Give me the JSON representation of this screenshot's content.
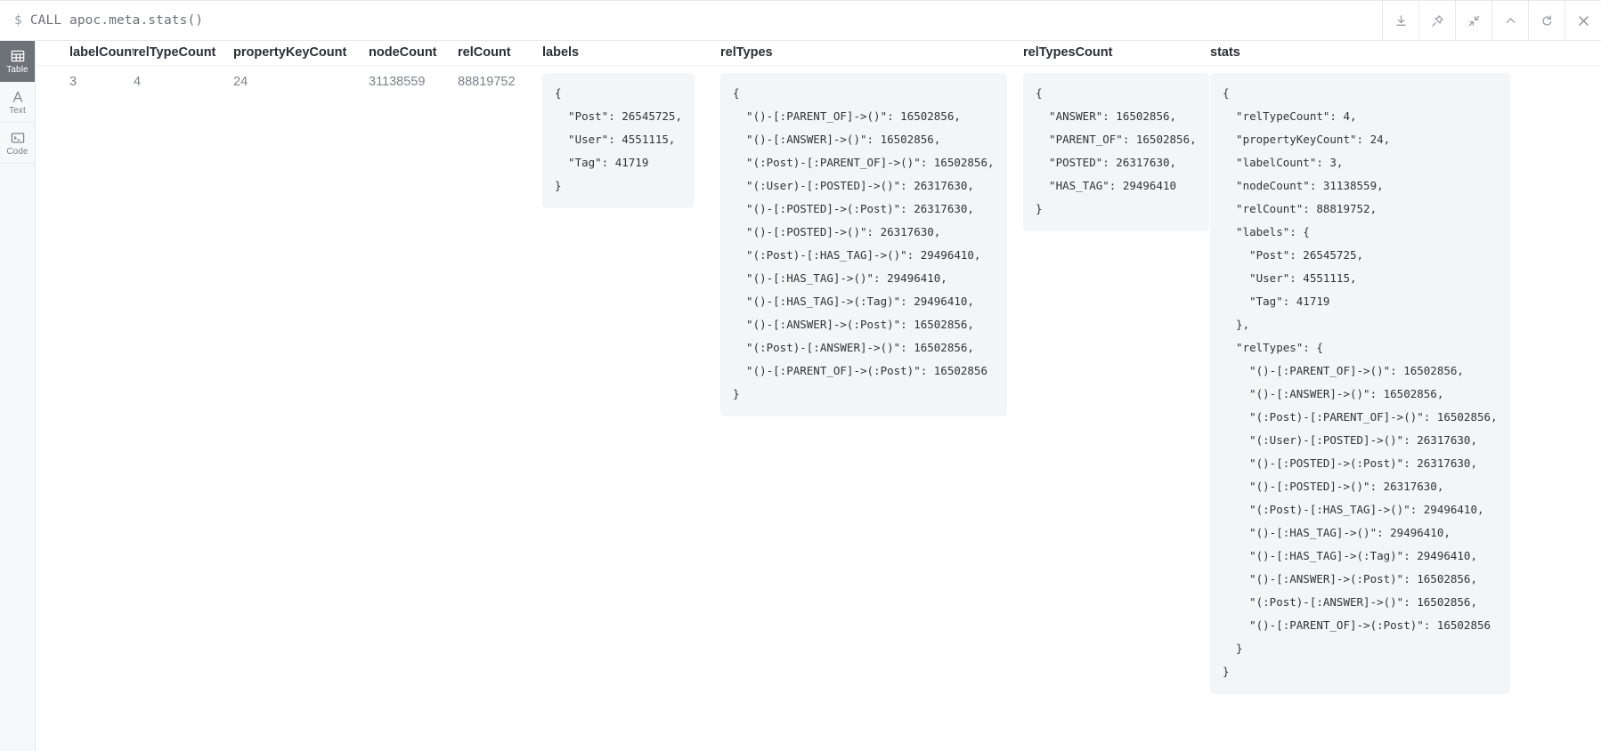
{
  "editor": {
    "prompt": "$",
    "query": "CALL apoc.meta.stats()",
    "actions": [
      {
        "name": "download-icon",
        "title": "Download"
      },
      {
        "name": "pin-icon",
        "title": "Pin"
      },
      {
        "name": "contract-icon",
        "title": "Contract"
      },
      {
        "name": "chevron-up-icon",
        "title": "Collapse"
      },
      {
        "name": "refresh-icon",
        "title": "Rerun"
      },
      {
        "name": "close-icon",
        "title": "Close"
      }
    ]
  },
  "view_sidebar": {
    "items": [
      {
        "label": "Table",
        "icon": "table-icon",
        "active": true
      },
      {
        "label": "Text",
        "icon": "text-icon",
        "active": false
      },
      {
        "label": "Code",
        "icon": "code-icon",
        "active": false
      }
    ]
  },
  "table": {
    "columns": [
      "labelCount",
      "relTypeCount",
      "propertyKeyCount",
      "nodeCount",
      "relCount",
      "labels",
      "relTypes",
      "relTypesCount",
      "stats"
    ],
    "row": {
      "labelCount": "3",
      "relTypeCount": "4",
      "propertyKeyCount": "24",
      "nodeCount": "31138559",
      "relCount": "88819752",
      "labels": "{\n  \"Post\": 26545725,\n  \"User\": 4551115,\n  \"Tag\": 41719\n}",
      "relTypes": "{\n  \"()-[:PARENT_OF]->()\": 16502856,\n  \"()-[:ANSWER]->()\": 16502856,\n  \"(:Post)-[:PARENT_OF]->()\": 16502856,\n  \"(:User)-[:POSTED]->()\": 26317630,\n  \"()-[:POSTED]->(:Post)\": 26317630,\n  \"()-[:POSTED]->()\": 26317630,\n  \"(:Post)-[:HAS_TAG]->()\": 29496410,\n  \"()-[:HAS_TAG]->()\": 29496410,\n  \"()-[:HAS_TAG]->(:Tag)\": 29496410,\n  \"()-[:ANSWER]->(:Post)\": 16502856,\n  \"(:Post)-[:ANSWER]->()\": 16502856,\n  \"()-[:PARENT_OF]->(:Post)\": 16502856\n}",
      "relTypesCount": "{\n  \"ANSWER\": 16502856,\n  \"PARENT_OF\": 16502856,\n  \"POSTED\": 26317630,\n  \"HAS_TAG\": 29496410\n}",
      "stats": "{\n  \"relTypeCount\": 4,\n  \"propertyKeyCount\": 24,\n  \"labelCount\": 3,\n  \"nodeCount\": 31138559,\n  \"relCount\": 88819752,\n  \"labels\": {\n    \"Post\": 26545725,\n    \"User\": 4551115,\n    \"Tag\": 41719\n  },\n  \"relTypes\": {\n    \"()-[:PARENT_OF]->()\": 16502856,\n    \"()-[:ANSWER]->()\": 16502856,\n    \"(:Post)-[:PARENT_OF]->()\": 16502856,\n    \"(:User)-[:POSTED]->()\": 26317630,\n    \"()-[:POSTED]->(:Post)\": 26317630,\n    \"()-[:POSTED]->()\": 26317630,\n    \"(:Post)-[:HAS_TAG]->()\": 29496410,\n    \"()-[:HAS_TAG]->()\": 29496410,\n    \"()-[:HAS_TAG]->(:Tag)\": 29496410,\n    \"()-[:ANSWER]->(:Post)\": 16502856,\n    \"(:Post)-[:ANSWER]->()\": 16502856,\n    \"()-[:PARENT_OF]->(:Post)\": 16502856\n  }\n}"
    }
  },
  "colors": {
    "sidebar_bg": "#f7f8fa",
    "active_tab_bg": "#6d7278",
    "json_bg": "#f4f5f6",
    "header_text": "#2a2f36",
    "cell_text": "#7d838b"
  }
}
